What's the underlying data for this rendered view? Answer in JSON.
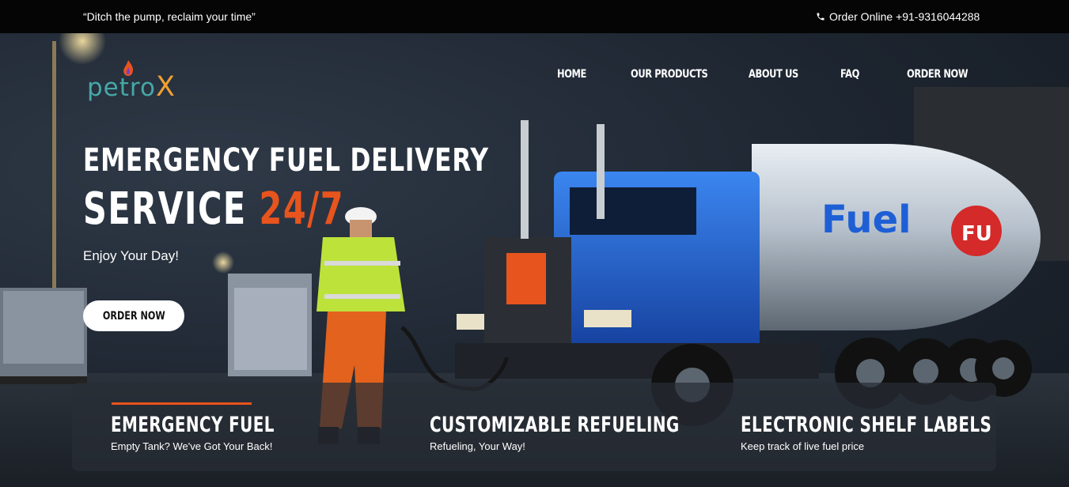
{
  "topbar": {
    "tagline": "“Ditch the pump, reclaim your time”",
    "contact": "Order Online +91-9316044288"
  },
  "logo": {
    "text_main": "petro",
    "text_x": "X"
  },
  "nav": {
    "items": [
      "HOME",
      "OUR PRODUCTS",
      "ABOUT US",
      "FAQ",
      "ORDER NOW"
    ]
  },
  "hero": {
    "headline_line1": "EMERGENCY FUEL DELIVERY",
    "headline_line2_white": "SERVICE ",
    "headline_line2_orange": "24/7",
    "subheading": "Enjoy Your Day!",
    "cta_label": "ORDER NOW",
    "truck_text": "Fuel",
    "truck_badge": "FU"
  },
  "features": [
    {
      "title": "EMERGENCY FUEL",
      "subtitle": "Empty Tank? We've Got Your Back!"
    },
    {
      "title": "CUSTOMIZABLE REFUELING",
      "subtitle": "Refueling, Your Way!"
    },
    {
      "title": "ELECTRONIC SHELF LABELS",
      "subtitle": "Keep track of live fuel price"
    }
  ],
  "colors": {
    "accent": "#e8541d",
    "topbar": "#050505",
    "logo_teal": "#45a8a6",
    "logo_orange": "#f1a032",
    "truck_blue": "#1e5fd6"
  }
}
